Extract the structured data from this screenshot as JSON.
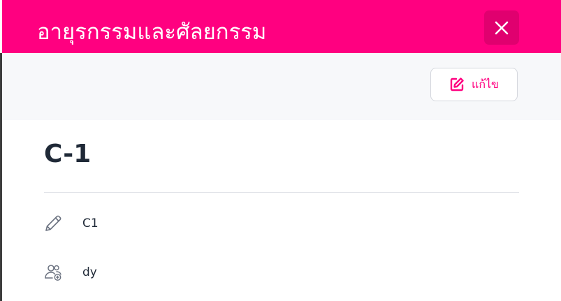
{
  "header": {
    "title": "อายุรกรรมและศัลยกรรม",
    "background_color": "#ff0080"
  },
  "close_button": {
    "icon": "close-icon"
  },
  "toolbar": {
    "edit_label": "แก้ไข",
    "edit_icon": "edit-square-icon",
    "accent_color": "#ff0080"
  },
  "detail": {
    "title": "C-1",
    "rows": [
      {
        "icon": "pencil-icon",
        "value": "C1"
      },
      {
        "icon": "users-add-icon",
        "value": "dy"
      }
    ]
  }
}
